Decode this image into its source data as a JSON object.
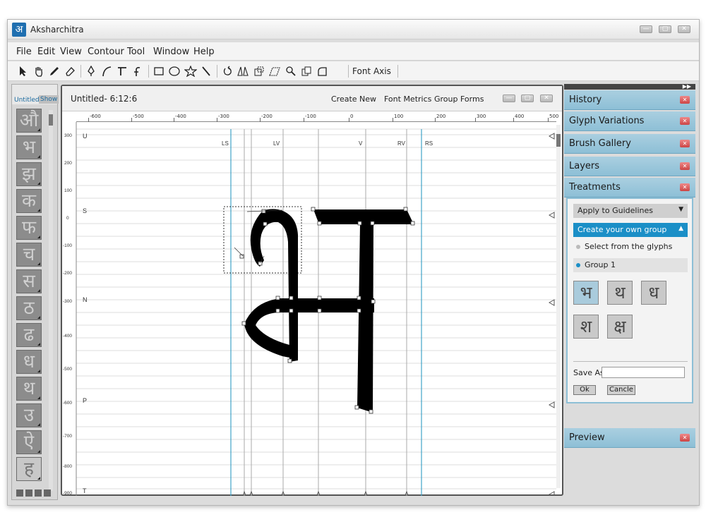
{
  "app": {
    "logo_glyph": "अ",
    "title": "Aksharchitra"
  },
  "window_controls": [
    "minimize",
    "maximize",
    "close"
  ],
  "menu": [
    "File",
    "Edit",
    "View",
    "Contour",
    "Tool",
    "Window",
    "Help"
  ],
  "toolbar": {
    "tools": [
      "pointer-icon",
      "hand-icon",
      "pen-nib-icon",
      "eraser-icon",
      "pen-tool-icon",
      "curve-icon",
      "t-bar-icon",
      "hook-icon",
      "rectangle-icon",
      "ellipse-icon",
      "star-icon",
      "line-icon",
      "rotate-icon",
      "mirror-icon",
      "transform-icon",
      "skew-icon",
      "zoom-icon",
      "clone-icon",
      "corner-icon"
    ],
    "font_axis_label": "Font Axis"
  },
  "left_panel": {
    "tab_label": "Untitled",
    "show_label": "Show",
    "glyphs": [
      "औ",
      "भ",
      "झ",
      "क",
      "फ",
      "च",
      "स",
      "ठ",
      "ढ",
      "ध",
      "थ",
      "उ",
      "ऐ",
      "ह"
    ],
    "active_index": 13
  },
  "document": {
    "title": "Untitled- 6:12:6",
    "actions": [
      "Create New",
      "Font Metrics",
      "Group Forms"
    ],
    "ruler_ticks": [
      "-600",
      "-500",
      "-400",
      "-300",
      "-200",
      "-100",
      "0",
      "100",
      "200",
      "300",
      "400",
      "500"
    ],
    "left_ticks": [
      "300",
      "200",
      "100",
      "0",
      "-100",
      "-200",
      "-300",
      "-400",
      "-500",
      "-600",
      "-700",
      "-800",
      "-900"
    ],
    "guide_labels": [
      "LS",
      "LV",
      "V",
      "RV",
      "RS"
    ],
    "row_labels": [
      "U",
      "S",
      "N",
      "P",
      "T"
    ]
  },
  "right_panel": {
    "panels": [
      "History",
      "Glyph Variations",
      "Brush Gallery",
      "Layers",
      "Treatments",
      "Preview"
    ],
    "treatments": {
      "apply_dropdown": "Apply to Guidelines",
      "create_group": "Create your own group",
      "options": [
        "Select from the glyphs",
        "Group 1"
      ],
      "group_glyphs": [
        "भ",
        "थ",
        "ध",
        "श",
        "क्ष"
      ],
      "save_as_label": "Save As",
      "save_as_value": "",
      "ok_label": "Ok",
      "cancel_label": "Cancle"
    }
  }
}
